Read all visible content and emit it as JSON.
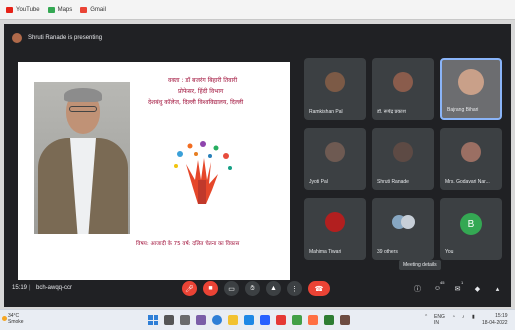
{
  "bookmarks": {
    "items": [
      {
        "label": "YouTube",
        "icon": "youtube-icon",
        "color": "#e62117"
      },
      {
        "label": "Maps",
        "icon": "maps-icon",
        "color": "#34a853"
      },
      {
        "label": "Gmail",
        "icon": "gmail-icon",
        "color": "#ea4335"
      }
    ]
  },
  "meet": {
    "presenter_banner": "Shruti Ranade is presenting",
    "time": "15:19",
    "separator": "|",
    "meeting_code": "bch-awqq-ccr",
    "tooltip": "Meeting details",
    "accent_end_call": "#ea4335",
    "accent_highlight": "#8ab4f8"
  },
  "slide": {
    "line1": "वक्ता : डॉ बजरंग बिहारी तिवारी",
    "line2": "प्रोफेसर, हिंदी विभाग",
    "line3": "देशबंधु कॉलेज, दिल्ली विश्वविद्यालय, दिल्ली",
    "caption": "विषय: आजादी के 75 वर्ष: दलित चेतना का विकास"
  },
  "participants": [
    {
      "name": "Ramkishan Pal",
      "avatar_color": "#7c5a46"
    },
    {
      "name": "डॉ. रूपेंद्र प्रकाश",
      "avatar_color": "#8a5c4c"
    },
    {
      "name": "Bajrang Bihari",
      "avatar_color": "#c9a089"
    },
    {
      "name": "Jyoti Pal",
      "avatar_color": "#6e5a52"
    },
    {
      "name": "Shruti Ranade",
      "avatar_color": "#5d4a44"
    },
    {
      "name": "Mrs. Godavari Nar...",
      "avatar_color": "#9b6f63"
    },
    {
      "name": "Mahima Tiwari",
      "avatar_color": "#b21f1f"
    },
    {
      "name": "39 others",
      "avatar_color": "#87a7c2"
    },
    {
      "name": "You",
      "letter": "B",
      "avatar_color": "#34a853"
    }
  ],
  "controls": {
    "mic_icon": "mic-off-icon",
    "camera_icon": "camera-off-icon",
    "captions_icon": "captions-icon",
    "hand_icon": "raise-hand-icon",
    "present_icon": "present-icon",
    "more_icon": "more-options-icon",
    "end_icon": "end-call-icon",
    "people_count": "45",
    "chat_count": "1"
  },
  "taskbar": {
    "weather_temp": "34°C",
    "weather_desc": "Smoke",
    "lang": "ENG",
    "lang_region": "IN",
    "time": "15:19",
    "date": "18-04-2022"
  }
}
